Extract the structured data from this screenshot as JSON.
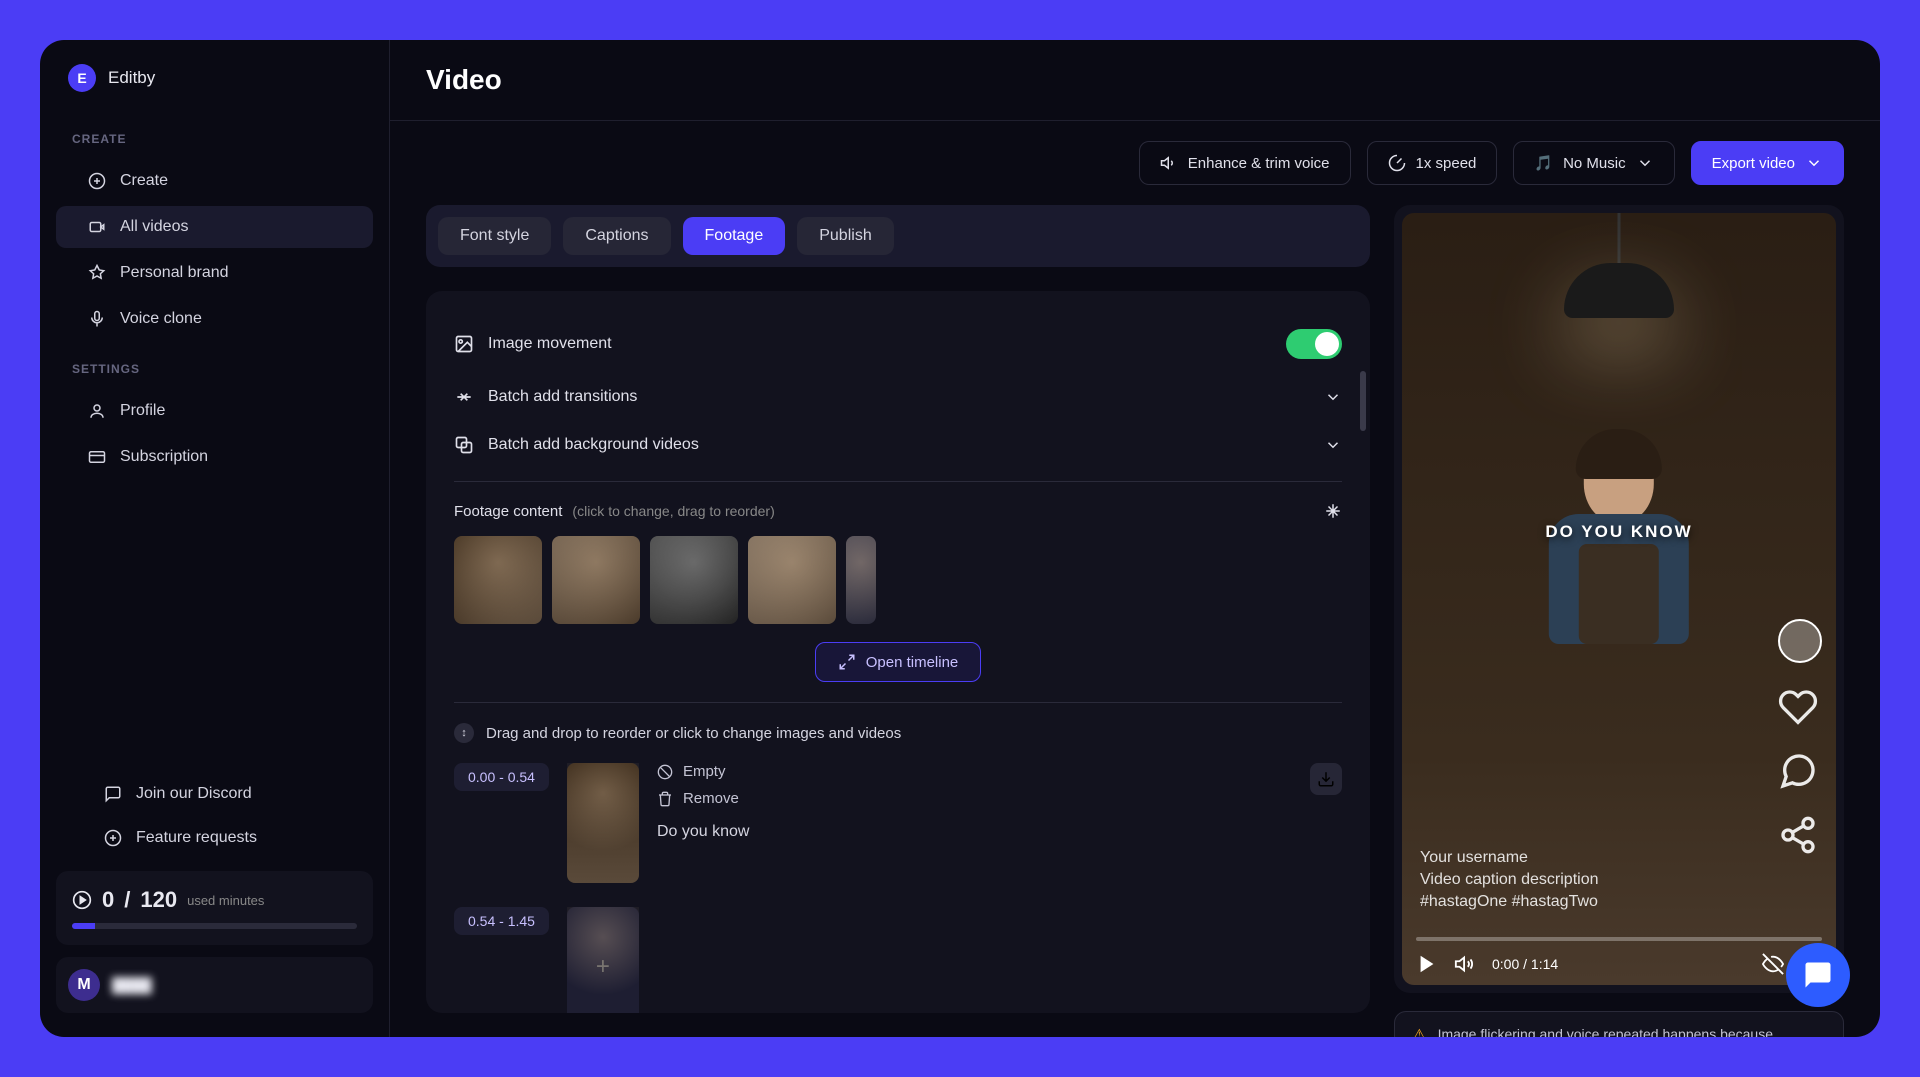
{
  "app": {
    "logo_letter": "E",
    "logo_text": "Editby"
  },
  "sidebar": {
    "section_create": "CREATE",
    "section_settings": "SETTINGS",
    "items_create": [
      {
        "label": "Create"
      },
      {
        "label": "All videos"
      },
      {
        "label": "Personal brand"
      },
      {
        "label": "Voice clone"
      }
    ],
    "items_settings": [
      {
        "label": "Profile"
      },
      {
        "label": "Subscription"
      }
    ],
    "footer": {
      "discord": "Join our Discord",
      "feature": "Feature requests"
    },
    "usage": {
      "used": "0",
      "sep": " / ",
      "total": "120",
      "suffix": "used minutes",
      "percent": 8
    },
    "user": {
      "initial": "M",
      "name": "████"
    }
  },
  "header": {
    "title": "Video"
  },
  "toolbar": {
    "enhance": "Enhance & trim voice",
    "speed": "1x speed",
    "music": "No Music",
    "music_emoji": "🎵",
    "export": "Export video"
  },
  "tabs": [
    "Font style",
    "Captions",
    "Footage",
    "Publish"
  ],
  "footage": {
    "image_movement": "Image movement",
    "batch_transitions": "Batch add transitions",
    "batch_bg": "Batch add background videos",
    "content_label": "Footage content",
    "content_hint": "(click to change, drag to reorder)",
    "open_timeline": "Open timeline",
    "drag_hint": "Drag and drop to reorder or click to change images and videos",
    "clips": [
      {
        "range": "0.00 - 0.54",
        "empty": "Empty",
        "remove": "Remove",
        "text": "Do you know"
      },
      {
        "range": "0.54 - 1.45"
      }
    ]
  },
  "preview": {
    "caption": "DO YOU KNOW",
    "username": "Your username",
    "desc": "Video caption description",
    "tags": "#hastagOne #hastagTwo",
    "time": "0:00 / 1:14"
  },
  "warning": {
    "text": "Image flickering and voice repeated happens because"
  }
}
